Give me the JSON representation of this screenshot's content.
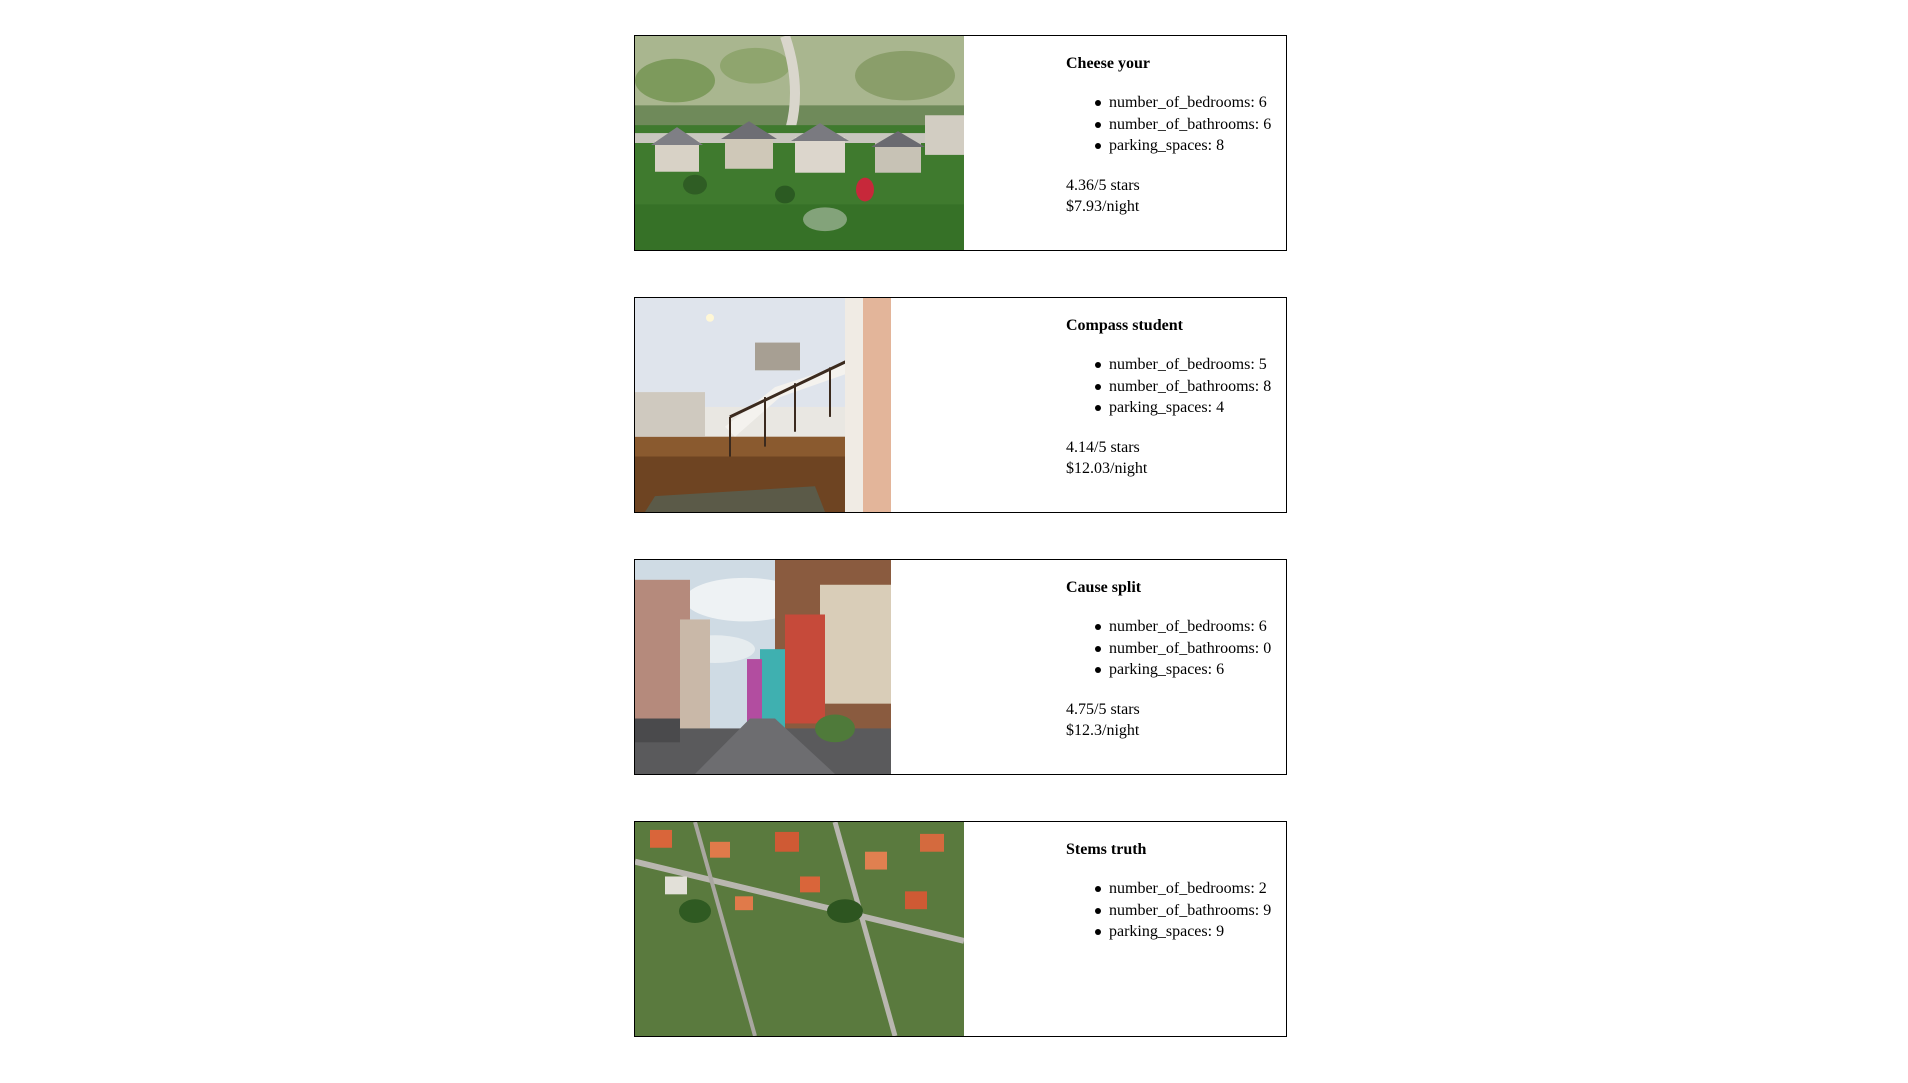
{
  "listings": [
    {
      "title": "Cheese your",
      "photo": "aerial suburban houses",
      "specs": [
        {
          "key": "number_of_bedrooms",
          "value": "6"
        },
        {
          "key": "number_of_bathrooms",
          "value": "6"
        },
        {
          "key": "parking_spaces",
          "value": "8"
        }
      ],
      "rating": "4.36/5 stars",
      "price": "$7.93/night"
    },
    {
      "title": "Compass student",
      "photo": "interior staircase hallway",
      "specs": [
        {
          "key": "number_of_bedrooms",
          "value": "5"
        },
        {
          "key": "number_of_bathrooms",
          "value": "8"
        },
        {
          "key": "parking_spaces",
          "value": "4"
        }
      ],
      "rating": "4.14/5 stars",
      "price": "$12.03/night"
    },
    {
      "title": "Cause split",
      "photo": "colorful street houses",
      "specs": [
        {
          "key": "number_of_bedrooms",
          "value": "6"
        },
        {
          "key": "number_of_bathrooms",
          "value": "0"
        },
        {
          "key": "parking_spaces",
          "value": "6"
        }
      ],
      "rating": "4.75/5 stars",
      "price": "$12.3/night"
    },
    {
      "title": "Stems truth",
      "photo": "aerial red roof neighborhood",
      "specs": [
        {
          "key": "number_of_bedrooms",
          "value": "2"
        },
        {
          "key": "number_of_bathrooms",
          "value": "9"
        },
        {
          "key": "parking_spaces",
          "value": "9"
        }
      ],
      "rating": "",
      "price": ""
    }
  ]
}
